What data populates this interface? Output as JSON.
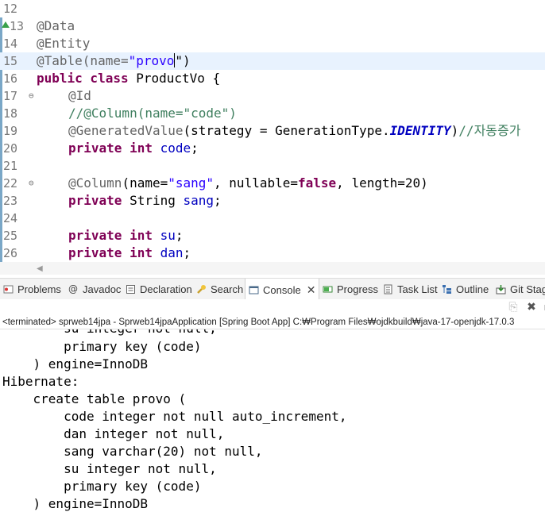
{
  "editor": {
    "lines": [
      {
        "num": "12",
        "text": ""
      },
      {
        "num": "13",
        "text": "@Data",
        "override_marker": true
      },
      {
        "num": "14",
        "text": "@Entity"
      },
      {
        "num": "15",
        "pre": "@Table(name=",
        "str": "\"provo",
        "post": "\")",
        "current": true
      },
      {
        "num": "16",
        "kw": "public class",
        "rest": " ProductVo {"
      },
      {
        "num": "17",
        "text": "@Id",
        "fold": true
      },
      {
        "num": "18",
        "text": "//@Column(name=\"code\")"
      },
      {
        "num": "19",
        "ann": "@GeneratedValue",
        "mid": "(strategy = GenerationType.",
        "cst": "IDENTITY",
        "end": ")",
        "cmt": "//자동증가"
      },
      {
        "num": "20",
        "kw": "private int",
        "fld": "code",
        "end": ";"
      },
      {
        "num": "21",
        "text": ""
      },
      {
        "num": "22",
        "ann": "@Column",
        "p1": "(name=",
        "str": "\"sang\"",
        "p2": ", nullable=",
        "kw": "false",
        "p3": ", length=20)",
        "fold": true
      },
      {
        "num": "23",
        "kw": "private",
        "mid": " String ",
        "fld": "sang",
        "end": ";"
      },
      {
        "num": "24",
        "text": ""
      },
      {
        "num": "25",
        "kw": "private int",
        "fld": "su",
        "end": ";"
      },
      {
        "num": "26",
        "kw": "private int",
        "fld": "dan",
        "end": ";"
      }
    ]
  },
  "tabs": [
    {
      "label": "Problems",
      "icon": "problems-icon"
    },
    {
      "label": "Javadoc",
      "icon": "javadoc-icon"
    },
    {
      "label": "Declaration",
      "icon": "declaration-icon"
    },
    {
      "label": "Search",
      "icon": "search-icon"
    },
    {
      "label": "Console",
      "icon": "console-icon",
      "active": true
    },
    {
      "label": "Progress",
      "icon": "progress-icon"
    },
    {
      "label": "Task List",
      "icon": "task-list-icon"
    },
    {
      "label": "Outline",
      "icon": "outline-icon"
    },
    {
      "label": "Git Stag",
      "icon": "git-staging-icon"
    }
  ],
  "console": {
    "status": "<terminated> sprweb14jpa - Sprweb14jpaApplication [Spring Boot App] C:₩Program Files₩ojdkbuild₩java-17-openjdk-17.0.3",
    "lines": [
      "        su integer not null,",
      "        primary key (code)",
      "    ) engine=InnoDB",
      "Hibernate: ",
      "    create table provo (",
      "        code integer not null auto_increment,",
      "        dan integer not null,",
      "        sang varchar(20) not null,",
      "        su integer not null,",
      "        primary key (code)",
      "    ) engine=InnoDB"
    ]
  },
  "colors": {
    "annotation": "#646464",
    "keyword": "#7f0055",
    "string": "#2a00ff",
    "field": "#0000c0",
    "comment": "#3f7f5f",
    "current_line": "#e8f2fe"
  }
}
